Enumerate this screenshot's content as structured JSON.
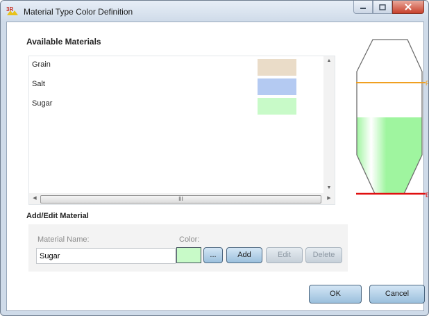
{
  "window": {
    "title": "Material Type Color Definition"
  },
  "available": {
    "label": "Available Materials",
    "materials": [
      {
        "name": "Grain",
        "color": "#eadcc8"
      },
      {
        "name": "Salt",
        "color": "#b4caf2"
      },
      {
        "name": "Sugar",
        "color": "#c8fac8"
      }
    ],
    "hscroll_grip": "III"
  },
  "edit": {
    "label": "Add/Edit Material",
    "name_label": "Material Name:",
    "name_value": "Sugar",
    "color_label": "Color:",
    "color_value": "#c8fac8",
    "browse_label": "...",
    "add_label": "Add",
    "edit_label": "Edit",
    "delete_label": "Delete"
  },
  "silo": {
    "fill_color": "#9ff59f",
    "full_line_color": "#f0a020",
    "empty_line_color": "#e01010",
    "full_marker": "F",
    "empty_marker": "E"
  },
  "footer": {
    "ok_label": "OK",
    "cancel_label": "Cancel"
  }
}
